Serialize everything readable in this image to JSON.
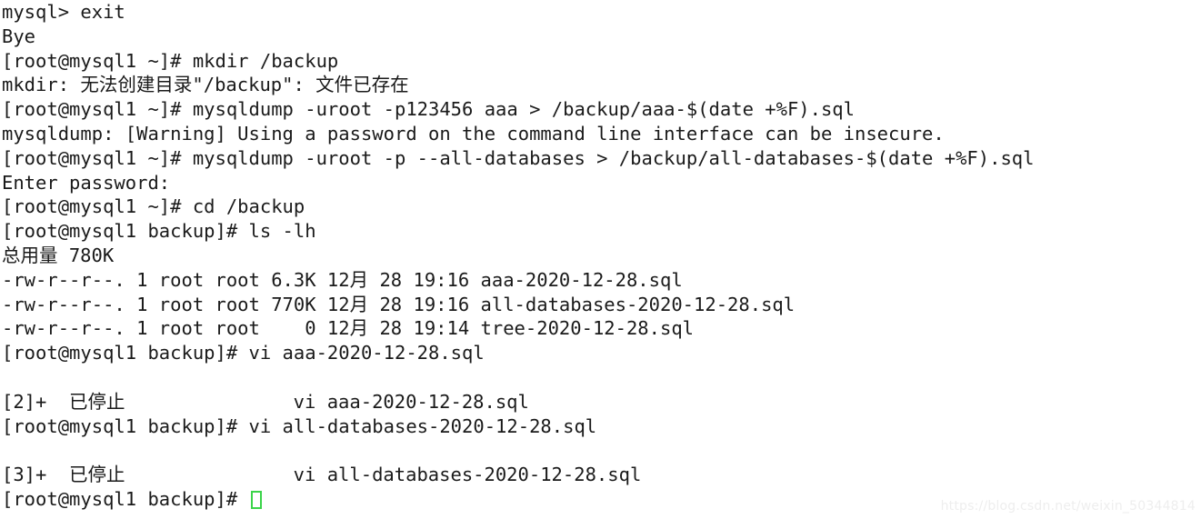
{
  "terminal": {
    "prompt_root_home": "[root@mysql1 ~]#",
    "prompt_root_backup": "[root@mysql1 backup]#",
    "cursor": "cursor-block",
    "colors": {
      "background": "#ffffff",
      "text": "#1a1a1a",
      "cursor_outline": "#3bd44a",
      "watermark": "#eeeeee"
    },
    "lines": [
      {
        "text": "mysql> exit",
        "kind": "prompt-mysql"
      },
      {
        "text": "Bye",
        "kind": "output"
      },
      {
        "text": "[root@mysql1 ~]# mkdir /backup",
        "kind": "command"
      },
      {
        "text": "mkdir: 无法创建目录\"/backup\": 文件已存在",
        "kind": "output"
      },
      {
        "text": "[root@mysql1 ~]# mysqldump -uroot -p123456 aaa > /backup/aaa-$(date +%F).sql",
        "kind": "command"
      },
      {
        "text": "mysqldump: [Warning] Using a password on the command line interface can be insecure.",
        "kind": "output"
      },
      {
        "text": "[root@mysql1 ~]# mysqldump -uroot -p --all-databases > /backup/all-databases-$(date +%F).sql",
        "kind": "command"
      },
      {
        "text": "Enter password:",
        "kind": "output"
      },
      {
        "text": "[root@mysql1 ~]# cd /backup",
        "kind": "command"
      },
      {
        "text": "[root@mysql1 backup]# ls -lh",
        "kind": "command"
      },
      {
        "text": "总用量 780K",
        "kind": "output"
      },
      {
        "text": "-rw-r--r--. 1 root root 6.3K 12月 28 19:16 aaa-2020-12-28.sql",
        "kind": "output"
      },
      {
        "text": "-rw-r--r--. 1 root root 770K 12月 28 19:16 all-databases-2020-12-28.sql",
        "kind": "output"
      },
      {
        "text": "-rw-r--r--. 1 root root    0 12月 28 19:14 tree-2020-12-28.sql",
        "kind": "output"
      },
      {
        "text": "[root@mysql1 backup]# vi aaa-2020-12-28.sql",
        "kind": "command"
      },
      {
        "text": "",
        "kind": "blank"
      },
      {
        "text": "[2]+  已停止               vi aaa-2020-12-28.sql",
        "kind": "output"
      },
      {
        "text": "[root@mysql1 backup]# vi all-databases-2020-12-28.sql",
        "kind": "command"
      },
      {
        "text": "",
        "kind": "blank"
      },
      {
        "text": "[3]+  已停止               vi all-databases-2020-12-28.sql",
        "kind": "output"
      },
      {
        "text": "[root@mysql1 backup]# ",
        "kind": "current-prompt"
      }
    ]
  },
  "watermark": {
    "text": "https://blog.csdn.net/weixin_50344814"
  },
  "file_listing": {
    "total_label": "总用量",
    "total_size": "780K",
    "columns": [
      "permissions",
      "links",
      "owner",
      "group",
      "size",
      "month",
      "day",
      "time",
      "name"
    ],
    "rows": [
      {
        "permissions": "-rw-r--r--.",
        "links": "1",
        "owner": "root",
        "group": "root",
        "size": "6.3K",
        "month": "12月",
        "day": "28",
        "time": "19:16",
        "name": "aaa-2020-12-28.sql"
      },
      {
        "permissions": "-rw-r--r--.",
        "links": "1",
        "owner": "root",
        "group": "root",
        "size": "770K",
        "month": "12月",
        "day": "28",
        "time": "19:16",
        "name": "all-databases-2020-12-28.sql"
      },
      {
        "permissions": "-rw-r--r--.",
        "links": "1",
        "owner": "root",
        "group": "root",
        "size": "0",
        "month": "12月",
        "day": "28",
        "time": "19:14",
        "name": "tree-2020-12-28.sql"
      }
    ]
  },
  "jobs": [
    {
      "id": "[2]+",
      "status": "已停止",
      "command": "vi aaa-2020-12-28.sql"
    },
    {
      "id": "[3]+",
      "status": "已停止",
      "command": "vi all-databases-2020-12-28.sql"
    }
  ]
}
